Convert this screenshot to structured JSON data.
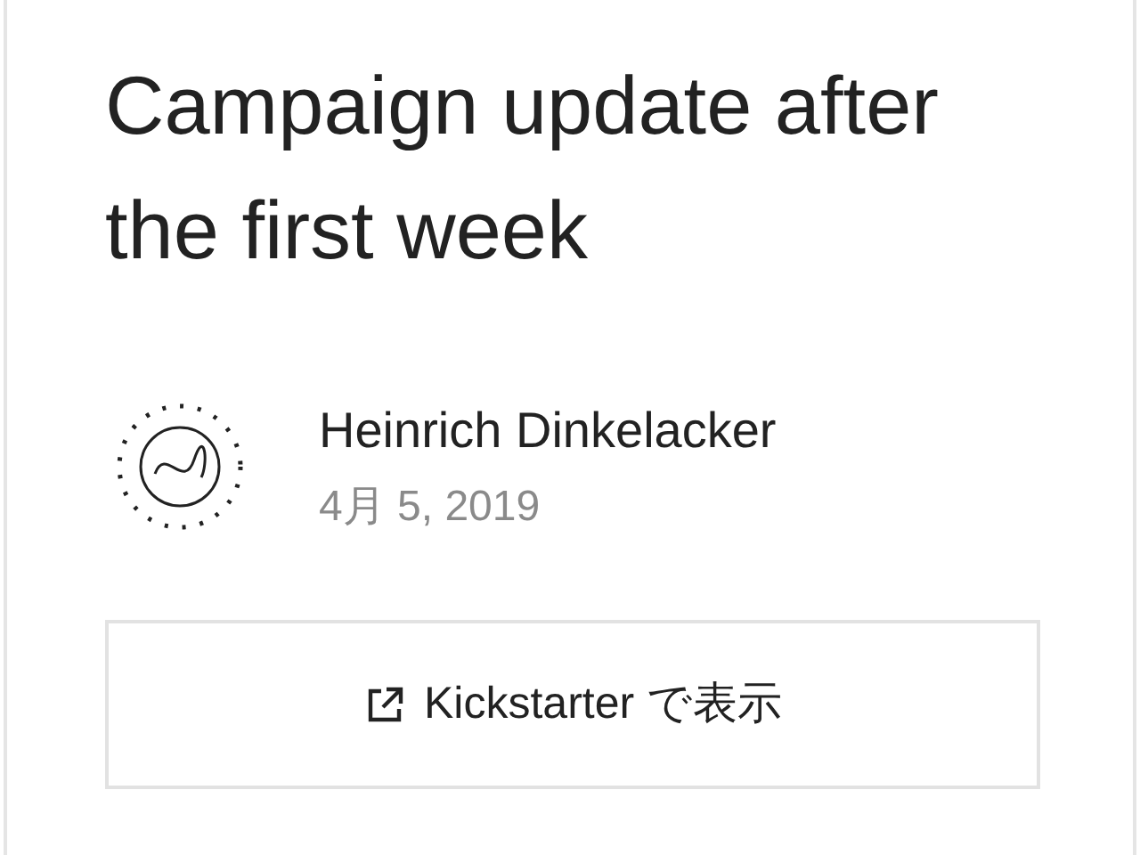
{
  "post": {
    "title": "Campaign update after the first week",
    "author": "Heinrich Dinkelacker",
    "date": "4月 5, 2019"
  },
  "button": {
    "label": "Kickstarter で表示"
  }
}
